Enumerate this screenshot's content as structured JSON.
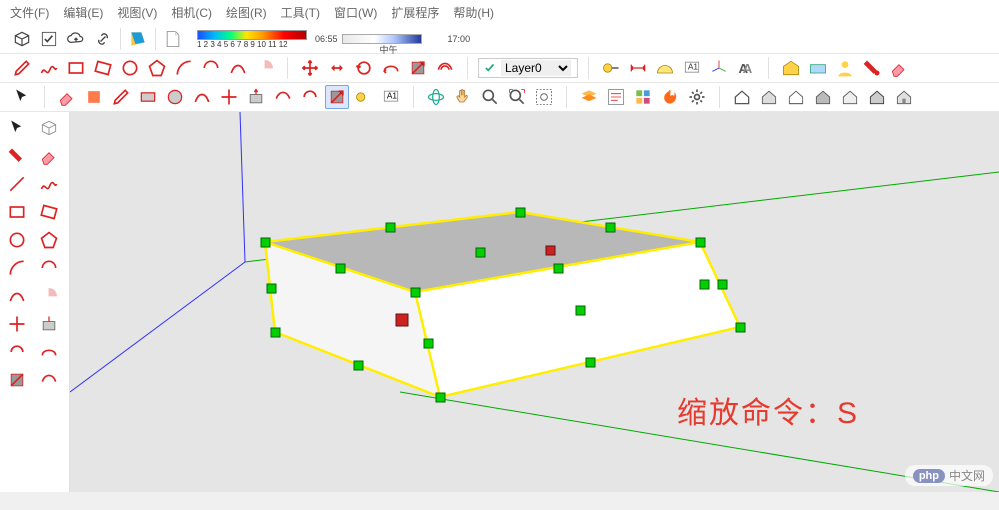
{
  "menu": {
    "file": "文件(F)",
    "edit": "编辑(E)",
    "view": "视图(V)",
    "camera": "相机(C)",
    "draw": "绘图(R)",
    "tools": "工具(T)",
    "window": "窗口(W)",
    "extensions": "扩展程序",
    "help": "帮助(H)"
  },
  "gradient": {
    "labels": "1  2  3  4  5  6  7  8  9  10  11  12"
  },
  "time": {
    "start": "06:55",
    "mid": "中午",
    "end": "17:00"
  },
  "layer": {
    "selected": "Layer0"
  },
  "overlay": {
    "text": "缩放命令：S"
  },
  "watermark": {
    "brand": "php",
    "site": "中文网"
  },
  "icons": {
    "cube": "cube",
    "check": "check",
    "cloud": "cloud",
    "link": "link",
    "swatch": "swatch",
    "paper": "paper",
    "move": "move",
    "paint": "paint",
    "arc": "arc",
    "scale": "scale",
    "rotate": "rotate",
    "offset": "offset",
    "text": "A",
    "warp": "warp",
    "tape": "tape",
    "protractor": "protractor",
    "pencil": "pencil",
    "rect": "rect",
    "circle": "circle",
    "arrow": "arrow",
    "eraser": "eraser",
    "hand": "hand",
    "orbit": "orbit",
    "house": "house",
    "layers": "layers",
    "fire": "fire",
    "settings": "settings",
    "folder": "folder"
  }
}
